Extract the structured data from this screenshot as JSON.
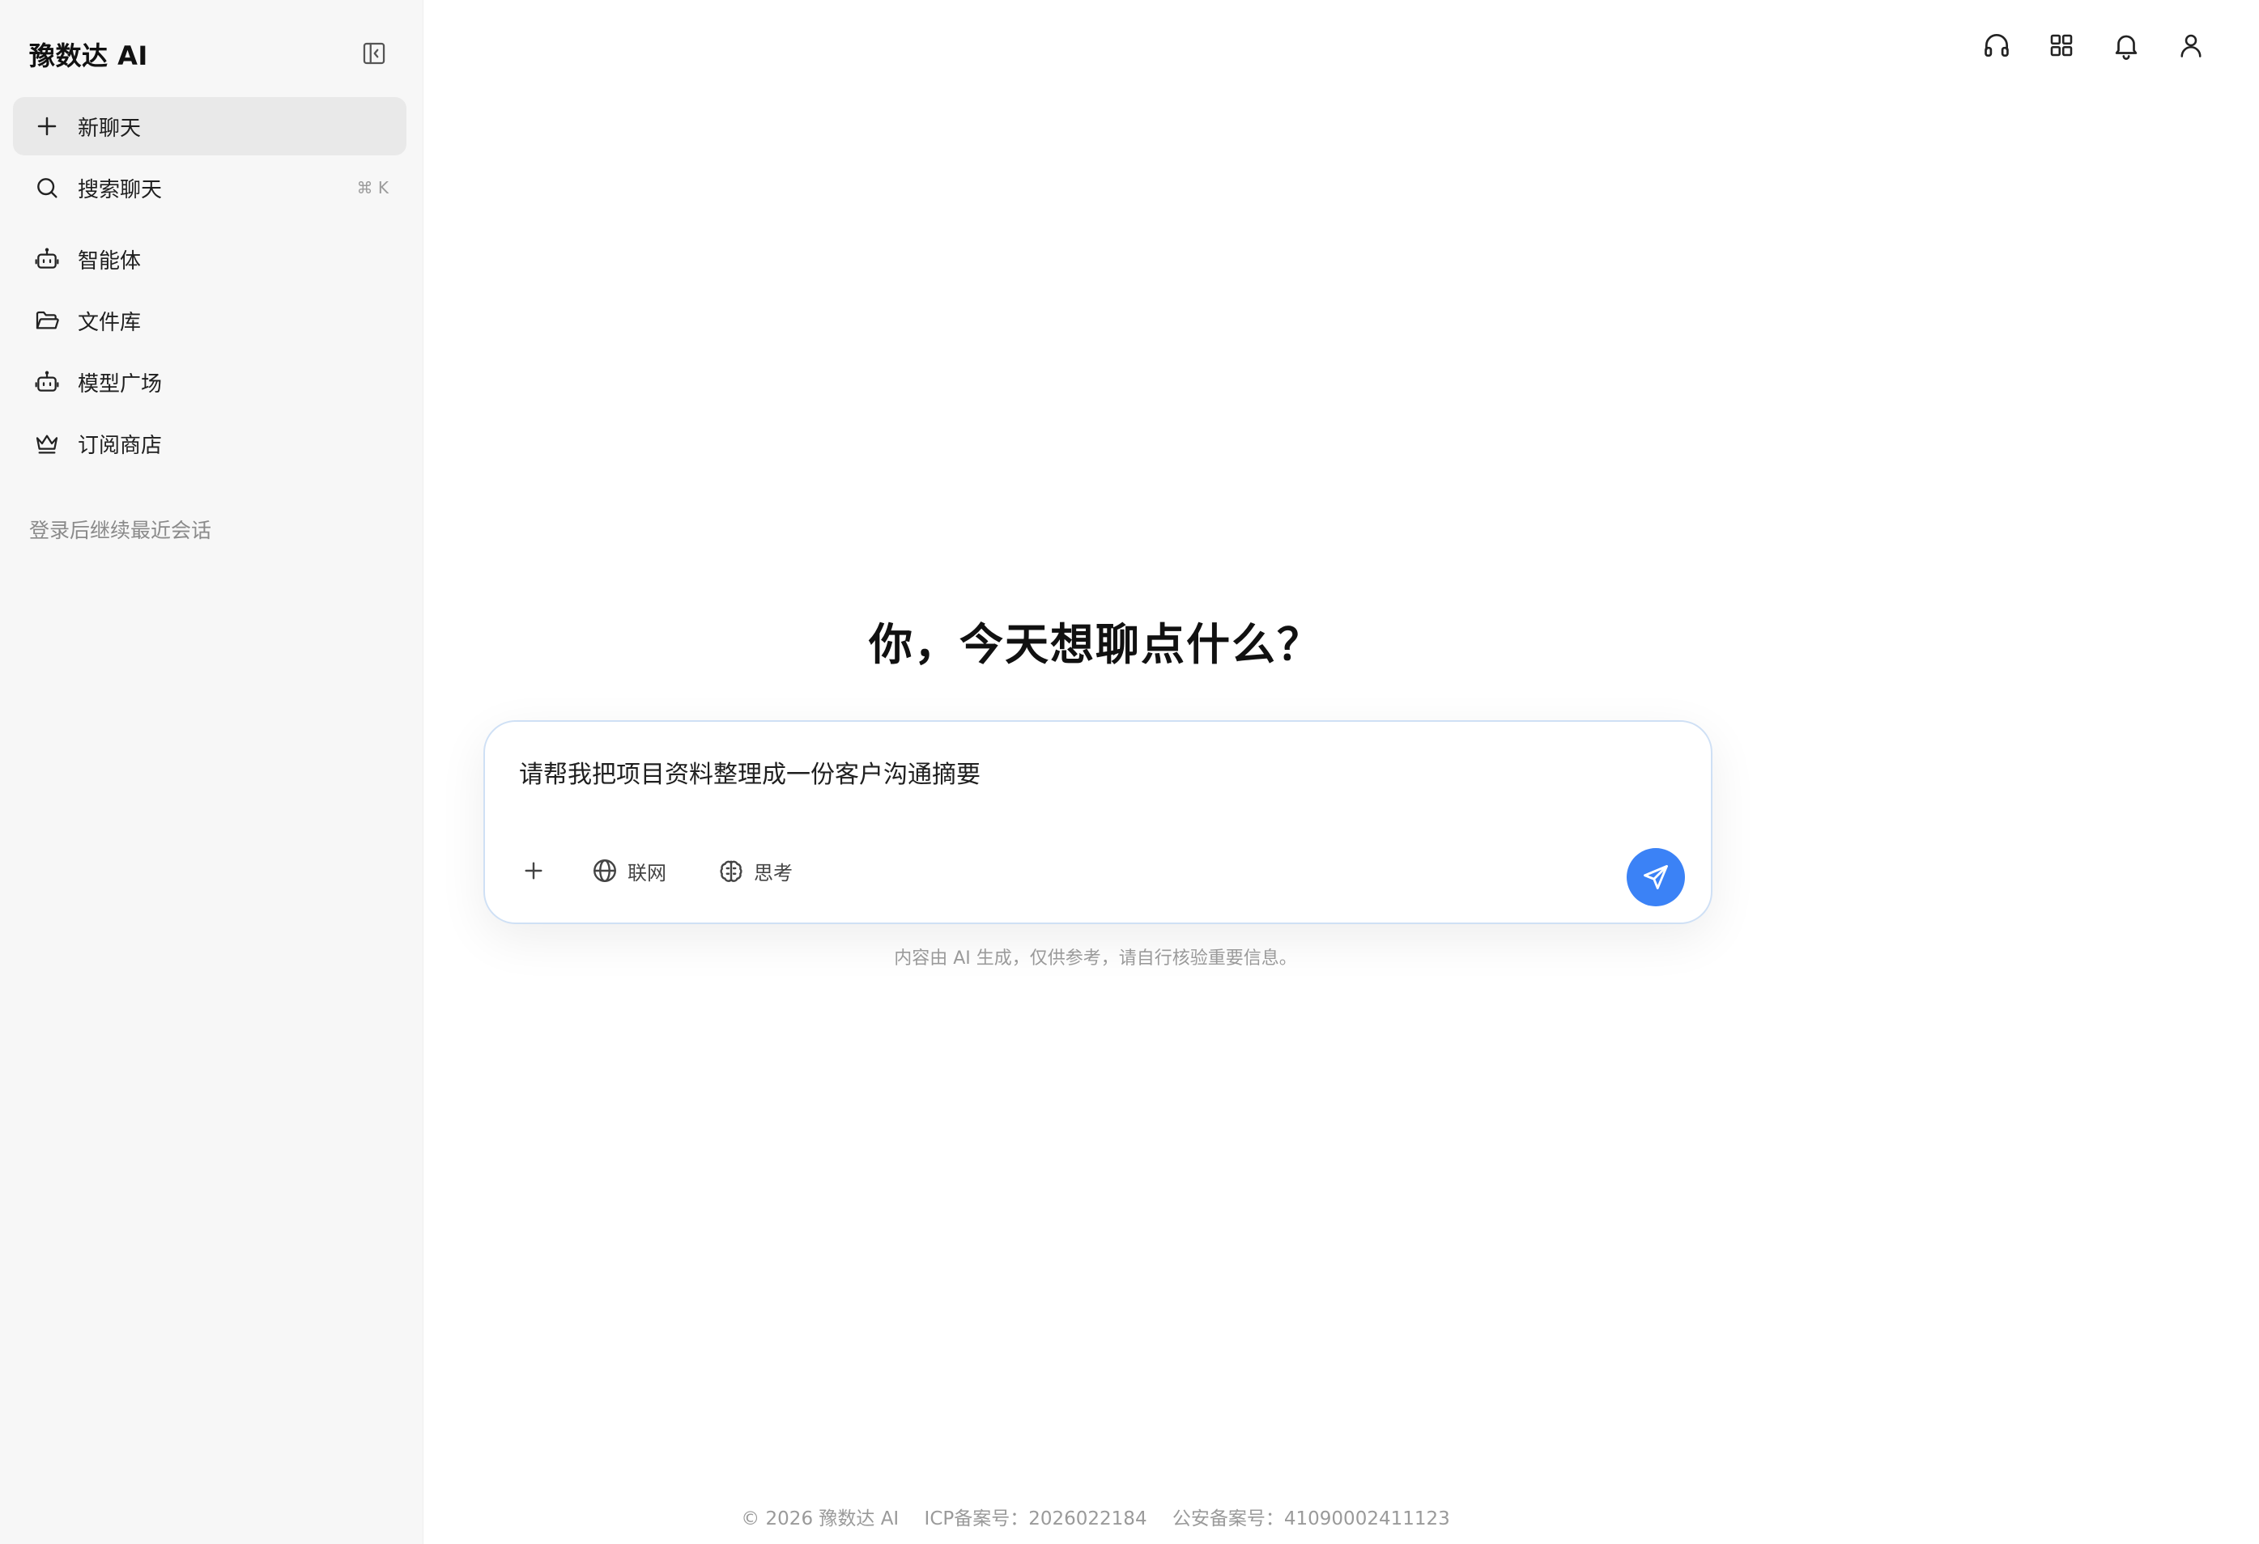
{
  "sidebar": {
    "brand": "豫数达 AI",
    "items": [
      {
        "label": "新聊天",
        "icon": "plus-icon"
      },
      {
        "label": "搜索聊天",
        "icon": "search-icon",
        "shortcut": "⌘ K"
      },
      {
        "label": "智能体",
        "icon": "robot-icon"
      },
      {
        "label": "文件库",
        "icon": "folder-icon"
      },
      {
        "label": "模型广场",
        "icon": "robot-icon"
      },
      {
        "label": "订阅商店",
        "icon": "crown-icon"
      }
    ],
    "login_hint": "登录后继续最近会话"
  },
  "topbar": {
    "icons": [
      "headset-icon",
      "grid-icon",
      "bell-icon",
      "user-icon"
    ]
  },
  "main": {
    "headline": "你，今天想聊点什么？",
    "composer": {
      "value": "请帮我把项目资料整理成一份客户沟通摘要",
      "tools": [
        {
          "label": "联网",
          "icon": "globe-icon"
        },
        {
          "label": "思考",
          "icon": "brain-icon"
        }
      ]
    },
    "disclaimer": "内容由 AI 生成，仅供参考，请自行核验重要信息。"
  },
  "footer": {
    "copyright": "© 2026 豫数达 AI",
    "icp": "ICP备案号：2026022184",
    "police": "公安备案号：41090002411123"
  },
  "colors": {
    "accent": "#3b82f6",
    "sidebar_bg": "#f7f7f7",
    "active_item_bg": "#e9e9e9"
  }
}
